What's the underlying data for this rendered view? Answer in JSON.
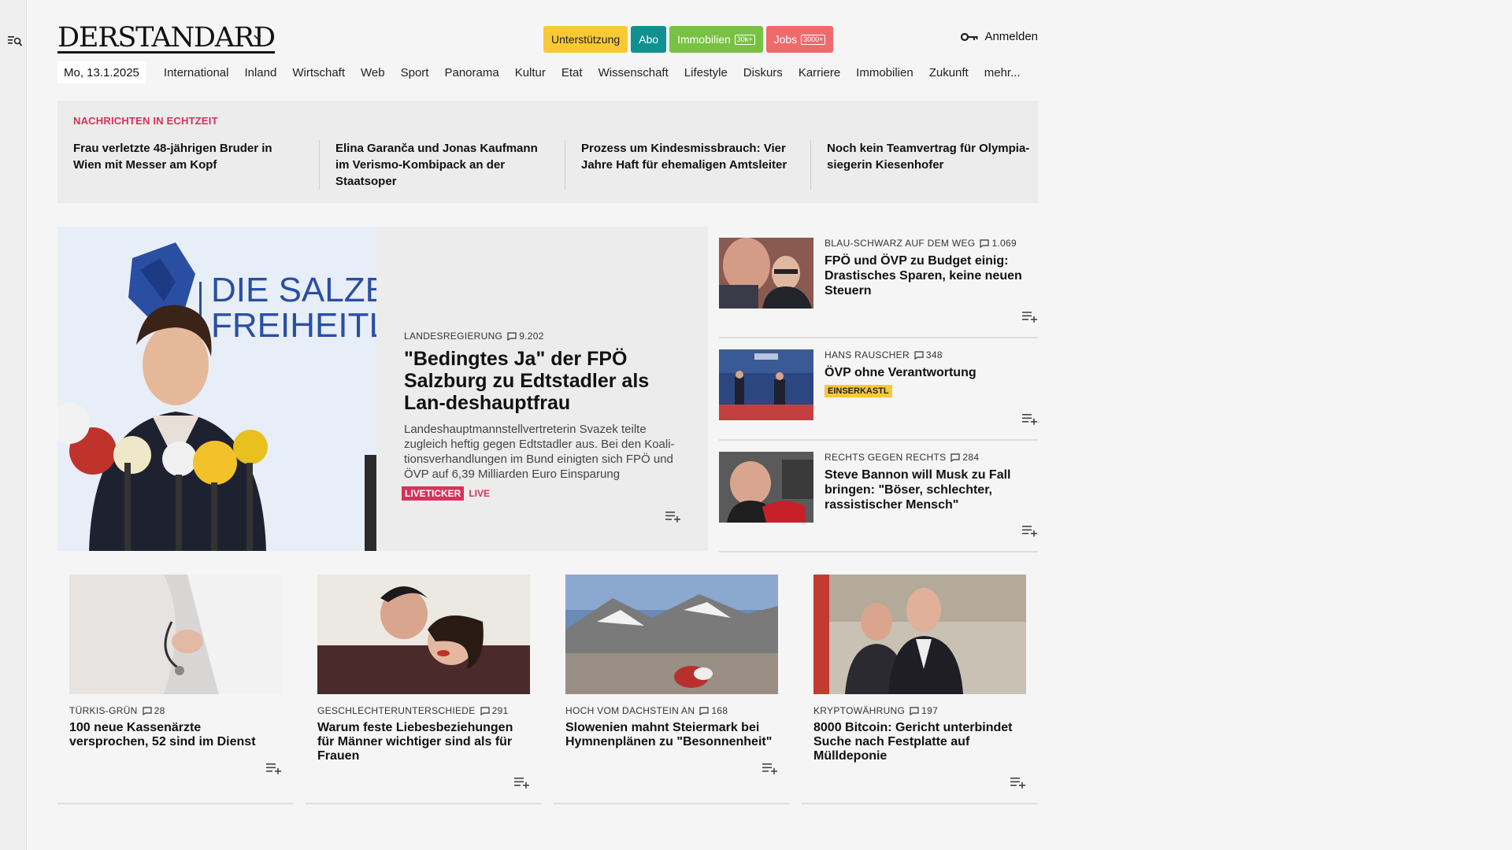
{
  "brand": {
    "logo": "DERSTANDARD"
  },
  "header": {
    "pills": [
      {
        "label": "Unterstützung",
        "tag": "",
        "color": "#f7c935"
      },
      {
        "label": "Abo",
        "tag": "",
        "color": "#10918f"
      },
      {
        "label": "Immobilien",
        "tag": "30k+",
        "color": "#78c142"
      },
      {
        "label": "Jobs",
        "tag": "3000+",
        "color": "#f0696b"
      }
    ],
    "login_label": "Anmelden"
  },
  "nav": {
    "date": "Mo, 13.1.2025",
    "items": [
      "International",
      "Inland",
      "Wirtschaft",
      "Web",
      "Sport",
      "Panorama",
      "Kultur",
      "Etat",
      "Wissenschaft",
      "Lifestyle",
      "Diskurs",
      "Karriere",
      "Immobilien",
      "Zukunft",
      "mehr..."
    ]
  },
  "ticker": {
    "label": "NACHRICHTEN IN ECHTZEIT",
    "items": [
      "Frau verletzte 48-jährigen Bruder in Wien mit Messer am Kopf",
      "Elina Garanča und Jonas Kaufmann im Verismo-Kombipack an der Staatsoper",
      "Prozess um Kindesmissbrauch: Vier Jahre Haft für ehemaligen Amtsleiter",
      "Noch kein Teamvertrag für Olympia-siegerin Kiesenhofer"
    ]
  },
  "lead": {
    "kicker": "LANDESREGIERUNG",
    "comments": "9.202",
    "title": "\"Bedingtes Ja\" der FPÖ Salzburg zu Edtstadler als Lan-deshauptfrau",
    "description": "Landeshauptmannstellvertreterin Svazek teilte zugleich heftig gegen Edtstadler aus. Bei den Koali-tionsverhandlungen im Bund einigten sich FPÖ und ÖVP auf 6,39 Milliarden Euro Einsparung",
    "badge": "LIVETICKER",
    "live": "LIVE",
    "image_text_line1": "DIE SALZBU",
    "image_text_line2": "FREIHEITLIC"
  },
  "side": [
    {
      "kicker": "BLAU-SCHWARZ AUF DEM WEG",
      "comments": "1.069",
      "title": "FPÖ und ÖVP zu Budget einig: Drastisches Sparen, keine neuen Steuern",
      "tag": ""
    },
    {
      "kicker": "HANS RAUSCHER",
      "comments": "348",
      "title": "ÖVP ohne Verantwortung",
      "tag": "EINSERKASTL"
    },
    {
      "kicker": "RECHTS GEGEN RECHTS",
      "comments": "284",
      "title": "Steve Bannon will Musk zu Fall bringen: \"Böser, schlechter, rassistischer Mensch\"",
      "tag": ""
    }
  ],
  "grid": [
    {
      "kicker": "TÜRKIS-GRÜN",
      "comments": "28",
      "title": "100 neue Kassenärzte versprochen, 52 sind im Dienst"
    },
    {
      "kicker": "GESCHLECHTERUNTERSCHIEDE",
      "comments": "291",
      "title": "Warum feste Liebesbeziehungen für Männer wichtiger sind als für Frauen"
    },
    {
      "kicker": "HOCH VOM DACHSTEIN AN",
      "comments": "168",
      "title": "Slowenien mahnt Steiermark bei Hymnenplänen zu \"Besonnenheit\""
    },
    {
      "kicker": "KRYPTOWÄHRUNG",
      "comments": "197",
      "title": "8000 Bitcoin: Gericht unterbindet Suche nach Festplatte auf Mülldeponie"
    }
  ]
}
